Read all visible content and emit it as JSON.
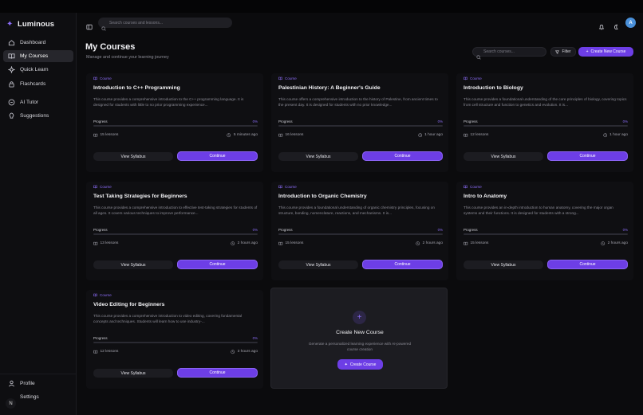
{
  "app": {
    "name": "Luminous"
  },
  "sidebar": {
    "items": [
      {
        "label": "Dashboard",
        "icon": "home-icon"
      },
      {
        "label": "My Courses",
        "icon": "book-icon",
        "active": true
      },
      {
        "label": "Quick Learn",
        "icon": "sparkle-icon"
      },
      {
        "label": "Flashcards",
        "icon": "lock-icon"
      },
      {
        "label": "AI Tutor",
        "icon": "chat-icon"
      },
      {
        "label": "Suggestions",
        "icon": "bulb-icon"
      }
    ],
    "bottom": {
      "profile_label": "Profile",
      "settings_label": "Settings",
      "avatar_initial": "N"
    }
  },
  "topbar": {
    "search_placeholder": "Search courses and lessons...",
    "avatar_initial": "A"
  },
  "header": {
    "title": "My Courses",
    "subtitle": "Manage and continue your learning journey",
    "search_placeholder": "Search courses...",
    "filter_label": "Filter",
    "create_label": "Create New Course"
  },
  "colors": {
    "accent": "#6d3ee6",
    "background": "#0b0b0d",
    "card": "#0f0f12"
  },
  "courses": [
    {
      "tag": "Course",
      "title": "Introduction to C++ Programming",
      "description": "This course provides a comprehensive introduction to the C++ programming language. It is designed for students with little to no prior programming experience...",
      "progress_label": "Progress",
      "progress": "0%",
      "lessons": "15 lessons",
      "time": "5 minutes ago",
      "syllabus_label": "View Syllabus",
      "continue_label": "Continue"
    },
    {
      "tag": "Course",
      "title": "Palestinian History: A Beginner's Guide",
      "description": "This course offers a comprehensive introduction to the history of Palestine, from ancient times to the present day. It is designed for students with no prior knowledge...",
      "progress_label": "Progress",
      "progress": "0%",
      "lessons": "16 lessons",
      "time": "1 hour ago",
      "syllabus_label": "View Syllabus",
      "continue_label": "Continue"
    },
    {
      "tag": "Course",
      "title": "Introduction to Biology",
      "description": "This course provides a foundational understanding of the core principles of biology, covering topics from cell structure and function to genetics and evolution. It is...",
      "progress_label": "Progress",
      "progress": "0%",
      "lessons": "12 lessons",
      "time": "1 hour ago",
      "syllabus_label": "View Syllabus",
      "continue_label": "Continue"
    },
    {
      "tag": "Course",
      "title": "Test Taking Strategies for Beginners",
      "description": "This course provides a comprehensive introduction to effective test-taking strategies for students of all ages. It covers various techniques to improve performance...",
      "progress_label": "Progress",
      "progress": "0%",
      "lessons": "13 lessons",
      "time": "2 hours ago",
      "syllabus_label": "View Syllabus",
      "continue_label": "Continue"
    },
    {
      "tag": "Course",
      "title": "Introduction to Organic Chemistry",
      "description": "This course provides a foundational understanding of organic chemistry principles, focusing on structure, bonding, nomenclature, reactions, and mechanisms. It is...",
      "progress_label": "Progress",
      "progress": "0%",
      "lessons": "15 lessons",
      "time": "2 hours ago",
      "syllabus_label": "View Syllabus",
      "continue_label": "Continue"
    },
    {
      "tag": "Course",
      "title": "Intro to Anatomy",
      "description": "This course provides an in-depth introduction to human anatomy, covering the major organ systems and their functions. It is designed for students with a strong...",
      "progress_label": "Progress",
      "progress": "0%",
      "lessons": "15 lessons",
      "time": "2 hours ago",
      "syllabus_label": "View Syllabus",
      "continue_label": "Continue"
    },
    {
      "tag": "Course",
      "title": "Video Editing for Beginners",
      "description": "This course provides a comprehensive introduction to video editing, covering fundamental concepts and techniques. Students will learn how to use industry-...",
      "progress_label": "Progress",
      "progress": "0%",
      "lessons": "12 lessons",
      "time": "3 hours ago",
      "syllabus_label": "View Syllabus",
      "continue_label": "Continue"
    }
  ],
  "new_course_card": {
    "title": "Create New Course",
    "description": "Generate a personalized learning experience with AI-powered course creation",
    "button_label": "Create Course"
  }
}
